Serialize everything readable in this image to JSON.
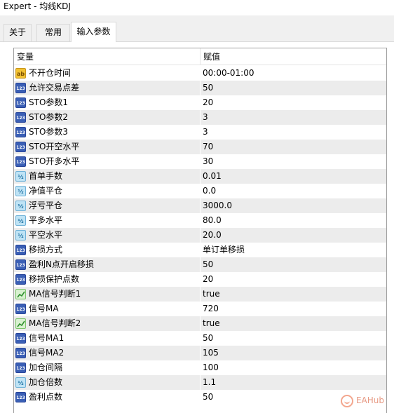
{
  "window": {
    "title": "Expert - 均线KDJ"
  },
  "tabs": [
    {
      "label": "关于",
      "active": false
    },
    {
      "label": "常用",
      "active": false
    },
    {
      "label": "输入参数",
      "active": true
    }
  ],
  "grid": {
    "columns": {
      "name": "变量",
      "value": "赋值"
    },
    "rows": [
      {
        "name": "不开仓时间",
        "value": "00:00-01:00",
        "type": "string",
        "icon": "ab-string-icon"
      },
      {
        "name": "允许交易点差",
        "value": "50",
        "type": "int",
        "icon": "123-int-icon"
      },
      {
        "name": "STO参数1",
        "value": "20",
        "type": "int",
        "icon": "123-int-icon"
      },
      {
        "name": "STO参数2",
        "value": "3",
        "type": "int",
        "icon": "123-int-icon"
      },
      {
        "name": "STO参数3",
        "value": "3",
        "type": "int",
        "icon": "123-int-icon"
      },
      {
        "name": "STO开空水平",
        "value": "70",
        "type": "int",
        "icon": "123-int-icon"
      },
      {
        "name": "STO开多水平",
        "value": "30",
        "type": "int",
        "icon": "123-int-icon"
      },
      {
        "name": "首单手数",
        "value": "0.01",
        "type": "double",
        "icon": "double-icon"
      },
      {
        "name": "净值平仓",
        "value": "0.0",
        "type": "double",
        "icon": "double-icon"
      },
      {
        "name": "浮亏平仓",
        "value": "3000.0",
        "type": "double",
        "icon": "double-icon"
      },
      {
        "name": "平多水平",
        "value": "80.0",
        "type": "double",
        "icon": "double-icon"
      },
      {
        "name": "平空水平",
        "value": "20.0",
        "type": "double",
        "icon": "double-icon"
      },
      {
        "name": "移损方式",
        "value": "单订单移损",
        "type": "int",
        "icon": "123-int-icon"
      },
      {
        "name": "盈利N点开启移损",
        "value": "50",
        "type": "int",
        "icon": "123-int-icon"
      },
      {
        "name": "移损保护点数",
        "value": "20",
        "type": "int",
        "icon": "123-int-icon"
      },
      {
        "name": "MA信号判断1",
        "value": "true",
        "type": "bool",
        "icon": "bool-chart-icon"
      },
      {
        "name": "信号MA",
        "value": "720",
        "type": "int",
        "icon": "123-int-icon"
      },
      {
        "name": "MA信号判断2",
        "value": "true",
        "type": "bool",
        "icon": "bool-chart-icon"
      },
      {
        "name": "信号MA1",
        "value": "50",
        "type": "int",
        "icon": "123-int-icon"
      },
      {
        "name": "信号MA2",
        "value": "105",
        "type": "int",
        "icon": "123-int-icon"
      },
      {
        "name": "加仓间隔",
        "value": "100",
        "type": "int",
        "icon": "123-int-icon"
      },
      {
        "name": "加仓倍数",
        "value": "1.1",
        "type": "double",
        "icon": "double-icon"
      },
      {
        "name": "盈利点数",
        "value": "50",
        "type": "int",
        "icon": "123-int-icon"
      }
    ]
  },
  "icon_glyphs": {
    "string": "ab",
    "int": "123",
    "double": "½"
  },
  "watermark": {
    "text": "EAHub"
  },
  "colors": {
    "row_alt": "#ececec",
    "int_icon": "#3a5fb5",
    "string_icon": "#f2c233",
    "double_icon": "#bfe3f5",
    "bool_icon": "#d8f1d0"
  }
}
